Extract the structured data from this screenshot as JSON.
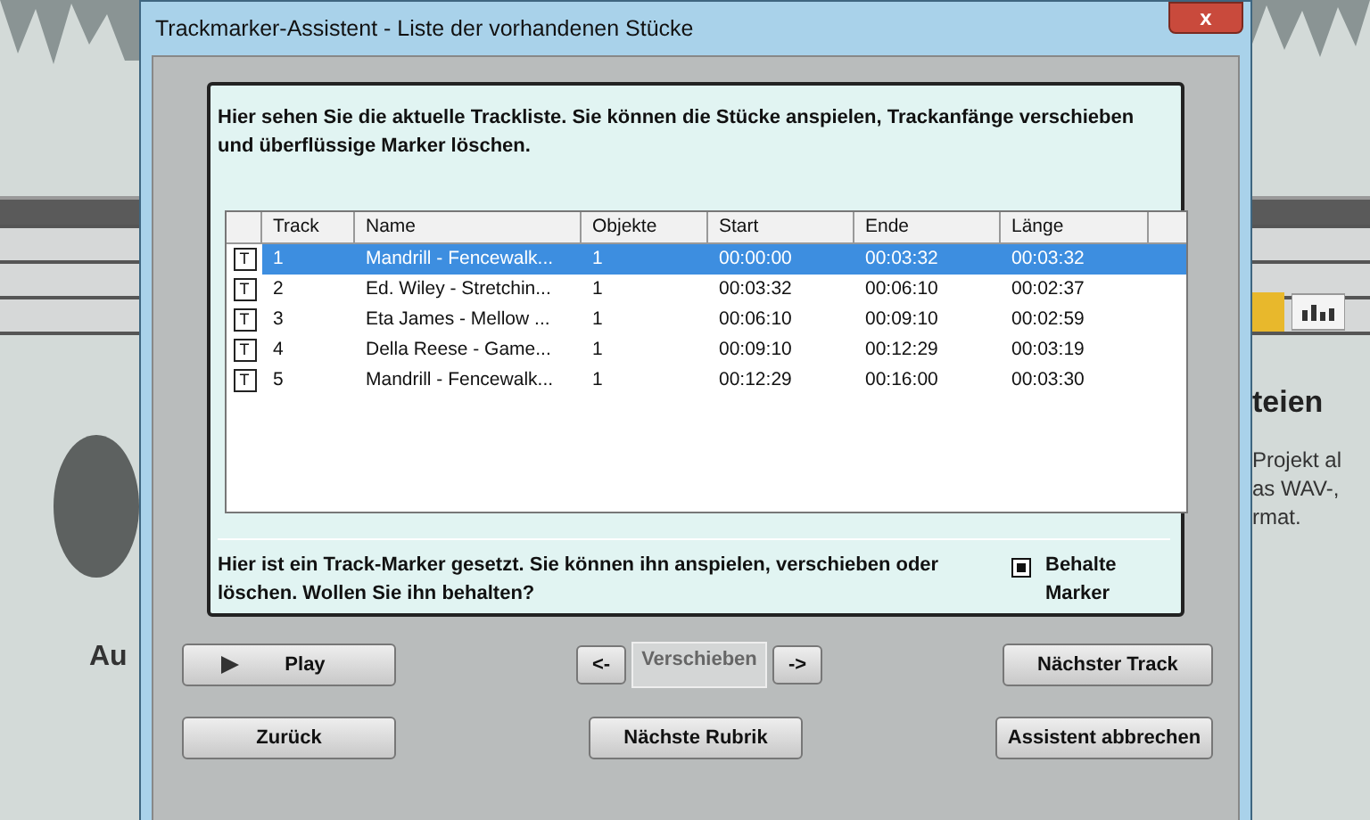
{
  "background_app": {
    "left_label": "Au",
    "right_heading": "teien",
    "right_lines": [
      "Projekt al",
      "as WAV-,",
      "rmat."
    ]
  },
  "window": {
    "title": "Trackmarker-Assistent - Liste der vorhandenen Stücke",
    "close": "x"
  },
  "intro": "Hier sehen Sie die aktuelle Trackliste. Sie können die Stücke anspielen, Trackanfänge verschieben und überflüssige Marker löschen.",
  "table": {
    "columns": [
      "Track",
      "Name",
      "Objekte",
      "Start",
      "Ende",
      "Länge"
    ],
    "rows": [
      {
        "type": "T",
        "track": "1",
        "name": "Mandrill - Fencewalk...",
        "objects": "1",
        "start": "00:00:00",
        "end": "00:03:32",
        "length": "00:03:32",
        "selected": true
      },
      {
        "type": "T",
        "track": "2",
        "name": "Ed. Wiley - Stretchin...",
        "objects": "1",
        "start": "00:03:32",
        "end": "00:06:10",
        "length": "00:02:37",
        "selected": false
      },
      {
        "type": "T",
        "track": "3",
        "name": "Eta James - Mellow ...",
        "objects": "1",
        "start": "00:06:10",
        "end": "00:09:10",
        "length": "00:02:59",
        "selected": false
      },
      {
        "type": "T",
        "track": "4",
        "name": "Della Reese - Game...",
        "objects": "1",
        "start": "00:09:10",
        "end": "00:12:29",
        "length": "00:03:19",
        "selected": false
      },
      {
        "type": "T",
        "track": "5",
        "name": "Mandrill - Fencewalk...",
        "objects": "1",
        "start": "00:12:29",
        "end": "00:16:00",
        "length": "00:03:30",
        "selected": false
      }
    ]
  },
  "marker_info": "Hier ist ein Track-Marker gesetzt. Sie können ihn anspielen, verschieben oder löschen. Wollen Sie ihn behalten?",
  "keep_marker": {
    "label": "Behalte Marker",
    "checked": true
  },
  "buttons": {
    "play": "Play",
    "move_left": "<-",
    "move_label": "Verschieben",
    "move_right": "->",
    "next_track": "Nächster Track",
    "back": "Zurück",
    "next_section": "Nächste Rubrik",
    "cancel": "Assistent abbrechen"
  }
}
